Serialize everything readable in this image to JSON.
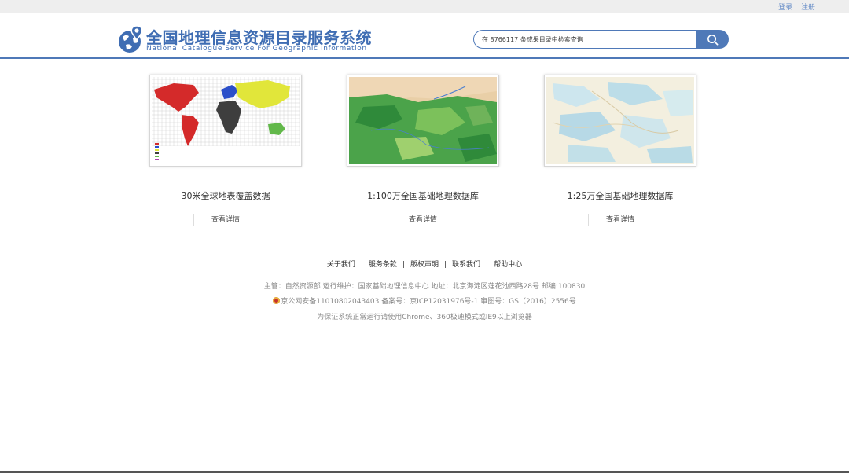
{
  "topbar": {
    "login": "登录",
    "register": "注册"
  },
  "header": {
    "title_cn": "全国地理信息资源目录服务系统",
    "title_en": "National Catalogue Service For Geographic Information"
  },
  "search": {
    "value": "在 8766117 条成果目录中检索查询"
  },
  "cards": [
    {
      "title": "30米全球地表覆盖数据",
      "detail": "查看详情"
    },
    {
      "title": "1:100万全国基础地理数据库",
      "detail": "查看详情"
    },
    {
      "title": "1:25万全国基础地理数据库",
      "detail": "查看详情"
    }
  ],
  "footer": {
    "links": [
      "关于我们",
      "服务条款",
      "版权声明",
      "联系我们",
      "帮助中心"
    ],
    "line1": "主管：自然资源部 运行维护：国家基础地理信息中心 地址：北京海淀区莲花池西路28号 邮编:100830",
    "line2": "京公网安备11010802043403 备案号：京ICP12031976号-1 审图号：GS（2016）2556号",
    "line3": "为保证系统正常运行请使用Chrome、360极速模式或IE9以上浏览器"
  },
  "colors": {
    "brand": "#4f79b8",
    "title": "#3f6db3"
  }
}
